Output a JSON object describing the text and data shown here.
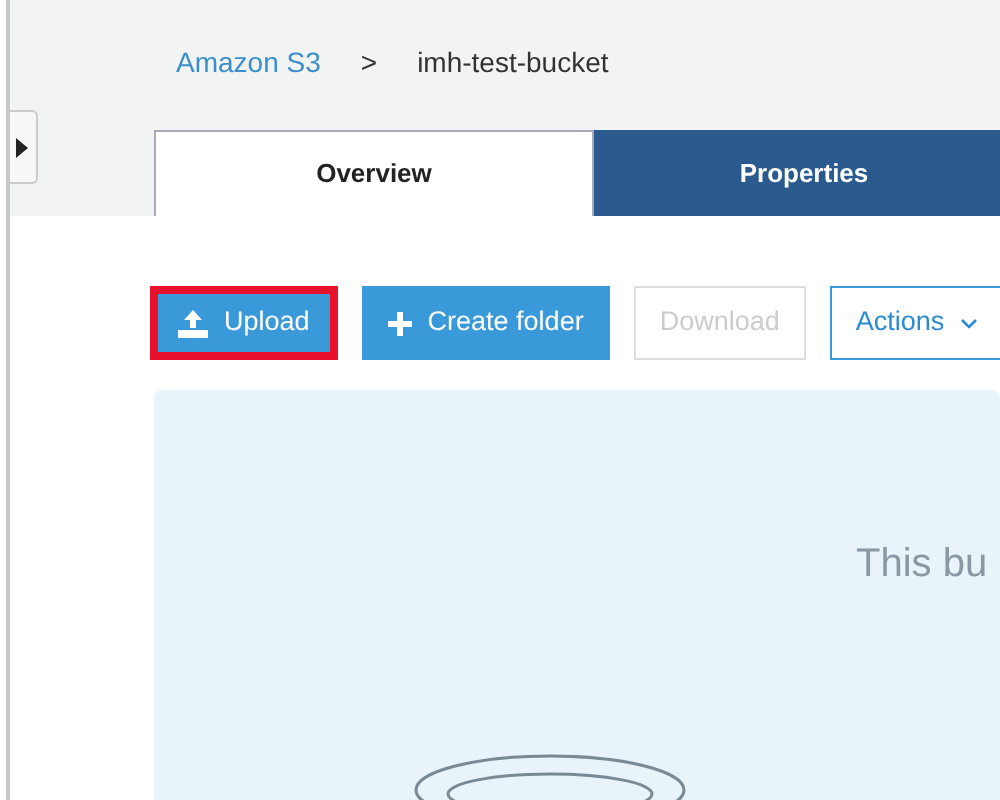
{
  "breadcrumb": [
    {
      "label": "Amazon S3",
      "kind": "link"
    },
    {
      "label": "imh-test-bucket",
      "kind": "current"
    }
  ],
  "breadcrumb_separator": ">",
  "tabs": [
    {
      "label": "Overview",
      "selected": true
    },
    {
      "label": "Properties",
      "selected": false
    }
  ],
  "toolbar": [
    {
      "label": "Upload",
      "kind": "upload",
      "highlighted": true,
      "disabled": false
    },
    {
      "label": "Create folder",
      "kind": "create",
      "highlighted": false,
      "disabled": false
    },
    {
      "label": "Download",
      "kind": "plain",
      "highlighted": false,
      "disabled": true
    },
    {
      "label": "Actions",
      "kind": "dropdown",
      "highlighted": false,
      "disabled": false
    }
  ],
  "empty_state": {
    "message": "This bu"
  }
}
